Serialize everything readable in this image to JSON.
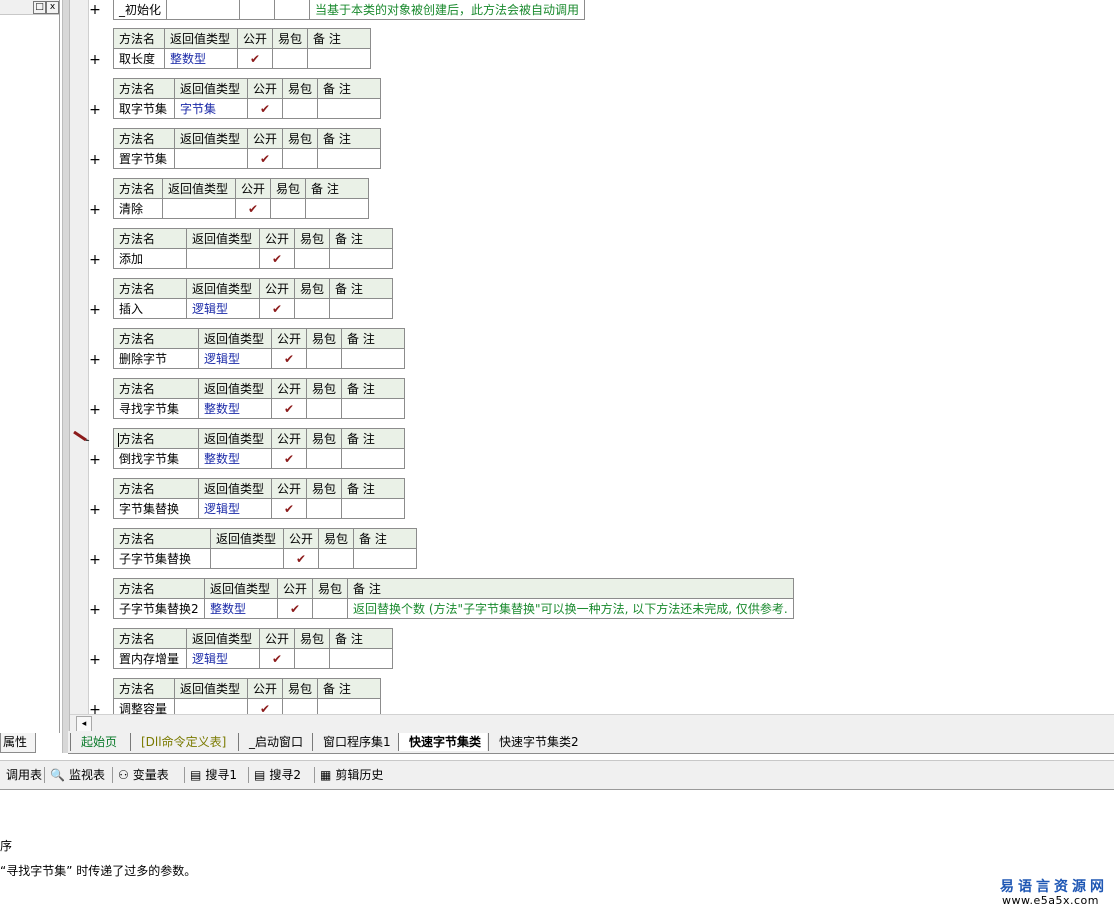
{
  "header_row": {
    "name": "_初始化",
    "note": "当基于本类的对象被创建后，此方法会被自动调用"
  },
  "columns": {
    "name": "方法名",
    "ret": "返回值类型",
    "pub": "公开",
    "easy": "易包",
    "note": "备 注"
  },
  "check_mark": "✔",
  "plus_symbol": "+",
  "methods": [
    {
      "name": "取长度",
      "ret": "整数型",
      "note": ""
    },
    {
      "name": "取字节集",
      "ret": "字节集",
      "note": ""
    },
    {
      "name": "置字节集",
      "ret": "",
      "note": ""
    },
    {
      "name": "清除",
      "ret": "",
      "note": ""
    },
    {
      "name": "添加",
      "ret": "",
      "note": ""
    },
    {
      "name": "插入",
      "ret": "逻辑型",
      "note": ""
    },
    {
      "name": "删除字节",
      "ret": "逻辑型",
      "note": ""
    },
    {
      "name": "寻找字节集",
      "ret": "整数型",
      "note": ""
    },
    {
      "name": "倒找字节集",
      "ret": "整数型",
      "note": ""
    },
    {
      "name": "字节集替换",
      "ret": "逻辑型",
      "note": ""
    },
    {
      "name": "子字节集替换",
      "ret": "",
      "note": ""
    },
    {
      "name": "子字节集替换2",
      "ret": "整数型",
      "note": "返回替换个数 (方法\"子字节集替换\"可以换一种方法, 以下方法还未完成, 仅供参考."
    },
    {
      "name": "置内存增量",
      "ret": "逻辑型",
      "note": ""
    },
    {
      "name": "调整容量",
      "ret": "",
      "note": ""
    }
  ],
  "left_panel": {
    "tab_label": "属性",
    "btn_restore": "□",
    "btn_close": "x"
  },
  "scroll_left_glyph": "◂",
  "tabs": [
    {
      "label": "起始页",
      "style": "green"
    },
    {
      "label": "[Dll命令定义表]",
      "style": "olive"
    },
    {
      "label": "_启动窗口",
      "style": "normal"
    },
    {
      "label": "窗口程序集1",
      "style": "normal"
    },
    {
      "label": "快速字节集类",
      "style": "active"
    },
    {
      "label": "快速字节集类2",
      "style": "normal"
    }
  ],
  "bottom_tools": [
    {
      "icon": "call-table-icon",
      "glyph": "",
      "label": "调用表"
    },
    {
      "icon": "magnifier-icon",
      "glyph": "🔍",
      "label": "监视表"
    },
    {
      "icon": "variable-icon",
      "glyph": "⚇",
      "label": "变量表"
    },
    {
      "icon": "search1-icon",
      "glyph": "▤",
      "label": "搜寻1"
    },
    {
      "icon": "search2-icon",
      "glyph": "▤",
      "label": "搜寻2"
    },
    {
      "icon": "clipboard-icon",
      "glyph": "▦",
      "label": "剪辑历史"
    }
  ],
  "output": {
    "line1": "序",
    "line2": "“寻找字节集” 时传递了过多的参数。"
  },
  "watermark": {
    "title": "易语言资源网",
    "url": "www.e5a5x.com"
  },
  "colors": {
    "header_bg": "#eaf1e7",
    "type_text": "#1b2aa8",
    "note_text": "#1a8a2e",
    "check": "#8c1b1b"
  }
}
